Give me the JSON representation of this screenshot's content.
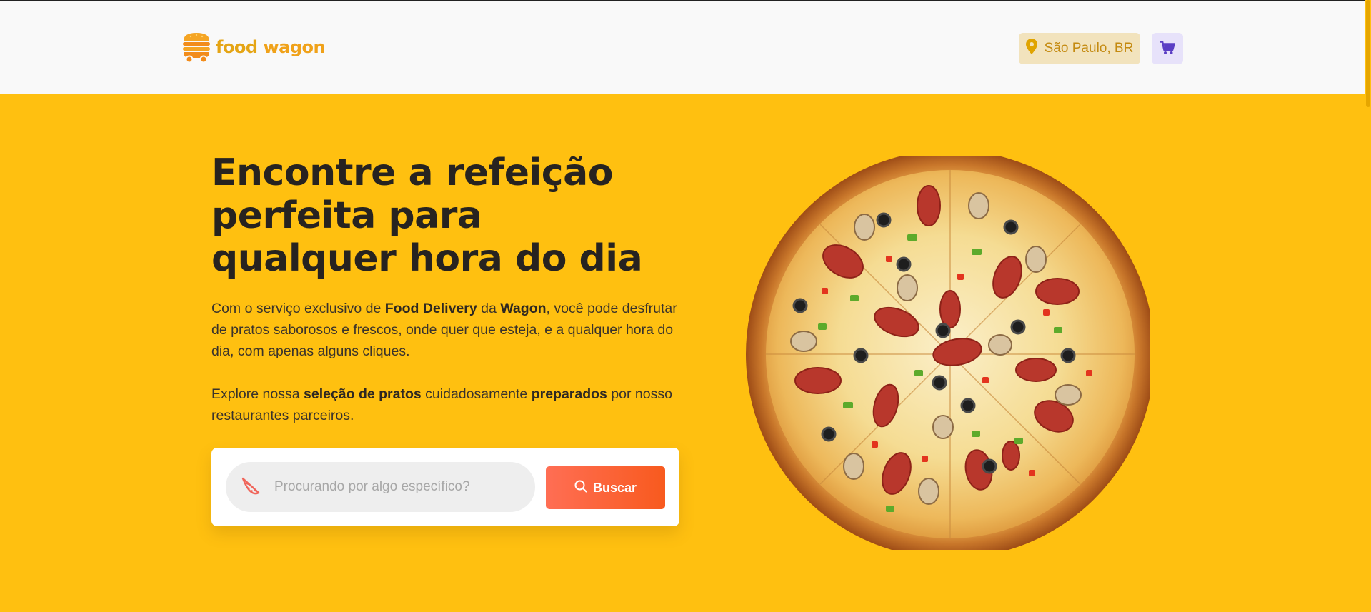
{
  "header": {
    "logo": {
      "word1": "food",
      "word2": "wagon"
    },
    "location_label": "São Paulo, BR"
  },
  "hero": {
    "title": "Encontre a refeição perfeita para qualquer hora do dia",
    "p1": {
      "t1": "Com o serviço exclusivo de ",
      "b1": "Food Delivery",
      "t2": " da ",
      "b2": "Wagon",
      "t3": ", você pode desfrutar de pratos saborosos e frescos, onde quer que esteja, e a qualquer hora do dia, com apenas alguns cliques."
    },
    "p2": {
      "t1": "Explore nossa ",
      "b1": "seleção de pratos",
      "t2": " cuidadosamente ",
      "b2": "preparados",
      "t3": " por nosso restaurantes parceiros."
    }
  },
  "search": {
    "placeholder": "Procurando por algo específico?",
    "button_label": "Buscar"
  },
  "colors": {
    "background": "#FFC010",
    "accent": "#F85A1E",
    "logo": "#F0A21A",
    "cart": "#5B3FC4"
  },
  "icons": [
    "food-wagon-logo-icon",
    "location-pin-icon",
    "cart-icon",
    "pizza-slice-icon",
    "search-icon"
  ]
}
